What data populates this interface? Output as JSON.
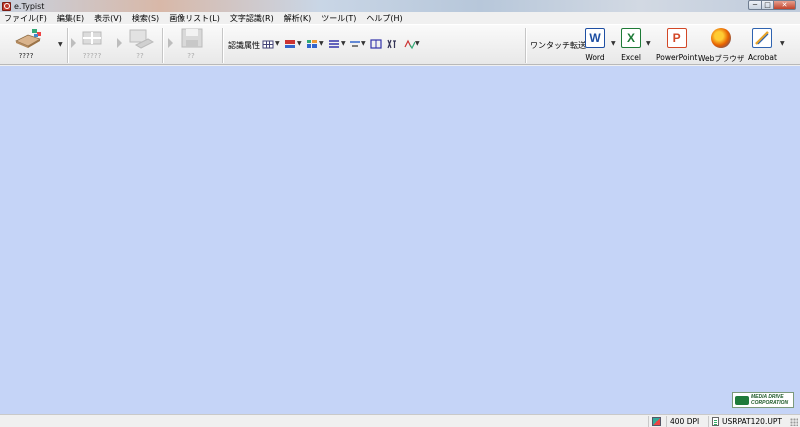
{
  "window": {
    "title": "e.Typist",
    "minimize_glyph": "─",
    "maximize_glyph": "□",
    "close_glyph": "✕"
  },
  "menu": {
    "items": [
      {
        "label": "ファイル(F)"
      },
      {
        "label": "編集(E)"
      },
      {
        "label": "表示(V)"
      },
      {
        "label": "検索(S)"
      },
      {
        "label": "画像リスト(L)"
      },
      {
        "label": "文字認識(R)"
      },
      {
        "label": "解析(K)"
      },
      {
        "label": "ツール(T)"
      },
      {
        "label": "ヘルプ(H)"
      }
    ]
  },
  "toolbar": {
    "scan_label": "????",
    "layout_label": "?????",
    "recognize_label": "??",
    "save_label": "??",
    "attr_label": "認識属性",
    "one_touch_label": "ワンタッチ転送",
    "apps": [
      {
        "label": "Word",
        "icon": "word-icon",
        "color": "#1e4fa3"
      },
      {
        "label": "Excel",
        "icon": "excel-icon",
        "color": "#1d7a36"
      },
      {
        "label": "PowerPoint",
        "icon": "powerpoint-icon",
        "color": "#d24726"
      },
      {
        "label": "Webブラウザ",
        "icon": "firefox-icon",
        "color": "#e66000"
      },
      {
        "label": "Acrobat",
        "icon": "acrobat-icon",
        "color": "#2f63b0"
      }
    ]
  },
  "main": {
    "background": "#c5d4f7",
    "brand_line1": "MEDIA DRIVE",
    "brand_line2": "CORPORATION"
  },
  "status": {
    "dpi": "400 DPI",
    "file": "USRPAT120.UPT"
  }
}
